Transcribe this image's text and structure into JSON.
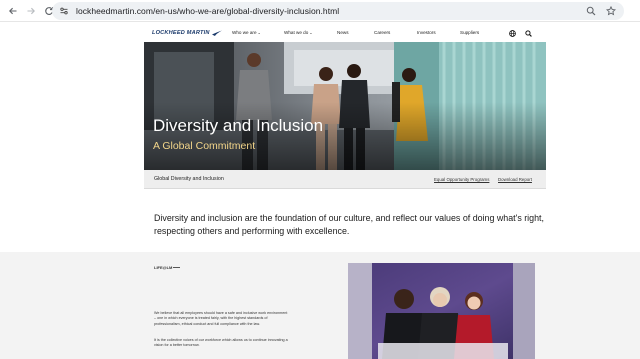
{
  "browser": {
    "url": "lockheedmartin.com/en-us/who-we-are/global-diversity-inclusion.html",
    "back_icon": "arrow-left",
    "forward_icon": "arrow-right",
    "reload_icon": "reload"
  },
  "header": {
    "logo_text": "LOCKHEED MARTIN",
    "menu": [
      {
        "label": "Who we are",
        "dropdown": true
      },
      {
        "label": "What we do",
        "dropdown": true
      },
      {
        "label": "News"
      },
      {
        "label": "Careers"
      },
      {
        "label": "Investors"
      },
      {
        "label": "Suppliers"
      }
    ],
    "caret": "⌄"
  },
  "hero": {
    "title": "Diversity and Inclusion",
    "subtitle": "A Global Commitment"
  },
  "subnav": {
    "title": "Global Diversity and Inclusion",
    "links": [
      "Equal Opportunity Programs",
      "Download Report"
    ]
  },
  "intro": {
    "text": "Diversity and inclusion are the foundation of our culture, and reflect our values of doing what's right, respecting others and performing with excellence."
  },
  "lower": {
    "brand": "LIFE@LM",
    "paragraph_1": "We believe that all employees should have a safe and inclusive work environment – one in which everyone is treated fairly, with the highest standards of professionalism, ethical conduct and full compliance with the law.",
    "paragraph_2": "It is the collective voices of our workforce which allows us to continue innovating a vision for a better tomorrow."
  },
  "colors": {
    "logo_blue": "#1b3a6b",
    "hero_subtitle": "#f2d58a",
    "subnav_bg": "#eeeeee"
  }
}
